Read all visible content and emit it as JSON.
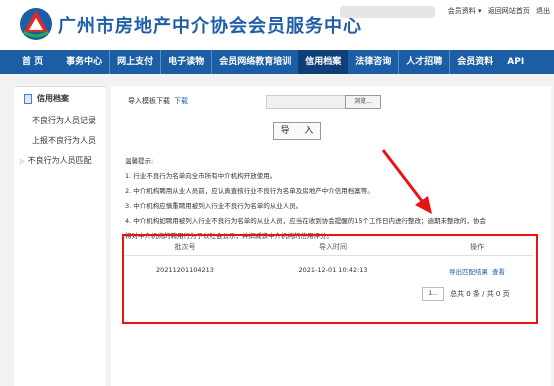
{
  "header": {
    "site_title": "广州市房地产中介协会会员服务中心",
    "links": [
      "会员资料 ▾",
      "返回网站首页",
      "退出"
    ]
  },
  "nav": {
    "items": [
      "首 页",
      "事务中心",
      "网上支付",
      "电子读物",
      "会员网络教育培训",
      "信用档案",
      "法律咨询",
      "人才招聘",
      "会员资料",
      "API"
    ],
    "active": "信用档案"
  },
  "sidebar": {
    "title": "信用档案",
    "items": [
      "不良行为人员记录",
      "上报不良行为人员",
      "不良行为人员匹配"
    ]
  },
  "import": {
    "template_label": "导入模板下载",
    "download_link": "下载",
    "browse_label": "浏览...",
    "import_button": "导 入"
  },
  "tips": {
    "title": "温馨提示:",
    "lines": [
      "1. 行业不良行为名单向全市所有中介机构开放使用。",
      "2. 中介机构聘用从业人员前，应认真查核行业不良行为名单及房地产中介信用档案等。",
      "3. 中介机构应慎重聘用被列入行业不良行为名单的从业人员。",
      "4. 中介机构如聘用被列入行业不良行为名单的从业人员，应当在收到协会提醒的15个工作日内进行整改；逾期未整改的，协会",
      "将对中介机构的聘用行为予以社会公示，并扣减该中介机构的信用评分。"
    ]
  },
  "grid": {
    "columns": [
      "批次号",
      "导入时间",
      "操作"
    ],
    "rows": [
      {
        "batch": "20211201104213",
        "time": "2021-12-01 10:42:13",
        "action1": "导出匹配结果",
        "action2": "查看"
      }
    ]
  },
  "pager": {
    "page_input": "1...",
    "summary": "总共 0 条  /  共 0 页"
  },
  "colors": {
    "nav": "#1c5ea5",
    "nav_active": "#0e3f78",
    "highlight": "#e81313",
    "link": "#1f5fa8"
  }
}
